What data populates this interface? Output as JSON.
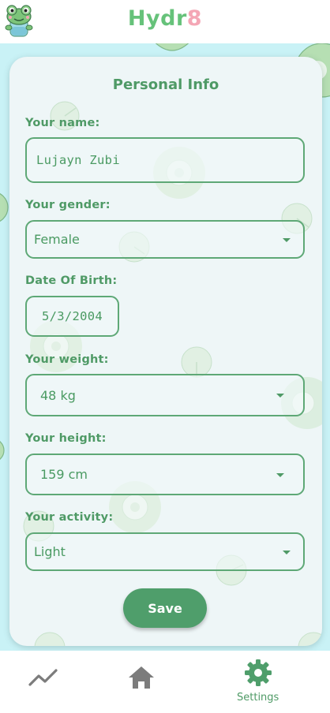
{
  "app": {
    "title_part1": "Hydr",
    "title_part2": "8"
  },
  "form": {
    "title": "Personal Info",
    "name": {
      "label": "Your name:",
      "value": "Lujayn Zubi"
    },
    "gender": {
      "label": "Your gender:",
      "value": "Female"
    },
    "dob": {
      "label": "Date Of Birth:",
      "value": "5/3/2004"
    },
    "weight": {
      "label": "Your weight:",
      "value": "48 kg"
    },
    "height": {
      "label": "Your height:",
      "value": "159 cm"
    },
    "activity": {
      "label": "Your activity:",
      "value": "Light"
    },
    "save_label": "Save"
  },
  "nav": {
    "items": [
      {
        "icon": "trending-up-icon",
        "label": ""
      },
      {
        "icon": "home-icon",
        "label": ""
      },
      {
        "icon": "gear-icon",
        "label": "Settings"
      }
    ]
  },
  "colors": {
    "accent": "#4f9e6b",
    "title_green": "#66c27a",
    "title_pink": "#f4a6b5",
    "background": "#c9f2f6",
    "card": "#eef6f7"
  }
}
